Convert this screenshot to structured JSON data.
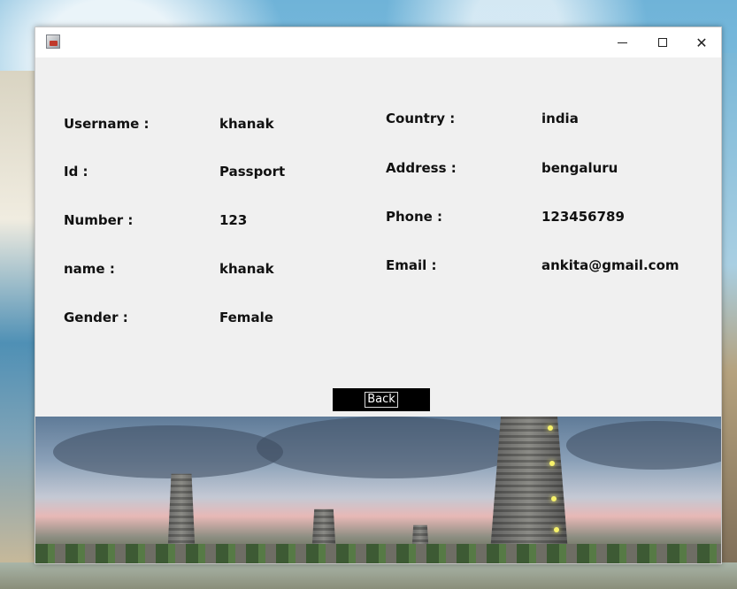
{
  "window": {
    "icon": "java-app-icon",
    "controls": {
      "minimize": "—",
      "maximize": "□",
      "close": "✕"
    }
  },
  "details": {
    "username_label": "Username :",
    "username_value": "khanak",
    "id_label": "Id :",
    "id_value": "Passport",
    "number_label": "Number :",
    "number_value": "123",
    "name_label": "name :",
    "name_value": "khanak",
    "gender_label": "Gender :",
    "gender_value": "Female",
    "country_label": "Country :",
    "country_value": "india",
    "address_label": "Address :",
    "address_value": "bengaluru",
    "phone_label": "Phone :",
    "phone_value": "123456789",
    "email_label": "Email :",
    "email_value": "ankita@gmail.com"
  },
  "actions": {
    "back_label": "Back"
  },
  "colors": {
    "window_bg": "#f0f0f0",
    "button_bg": "#000000",
    "button_text": "#ffffff"
  }
}
